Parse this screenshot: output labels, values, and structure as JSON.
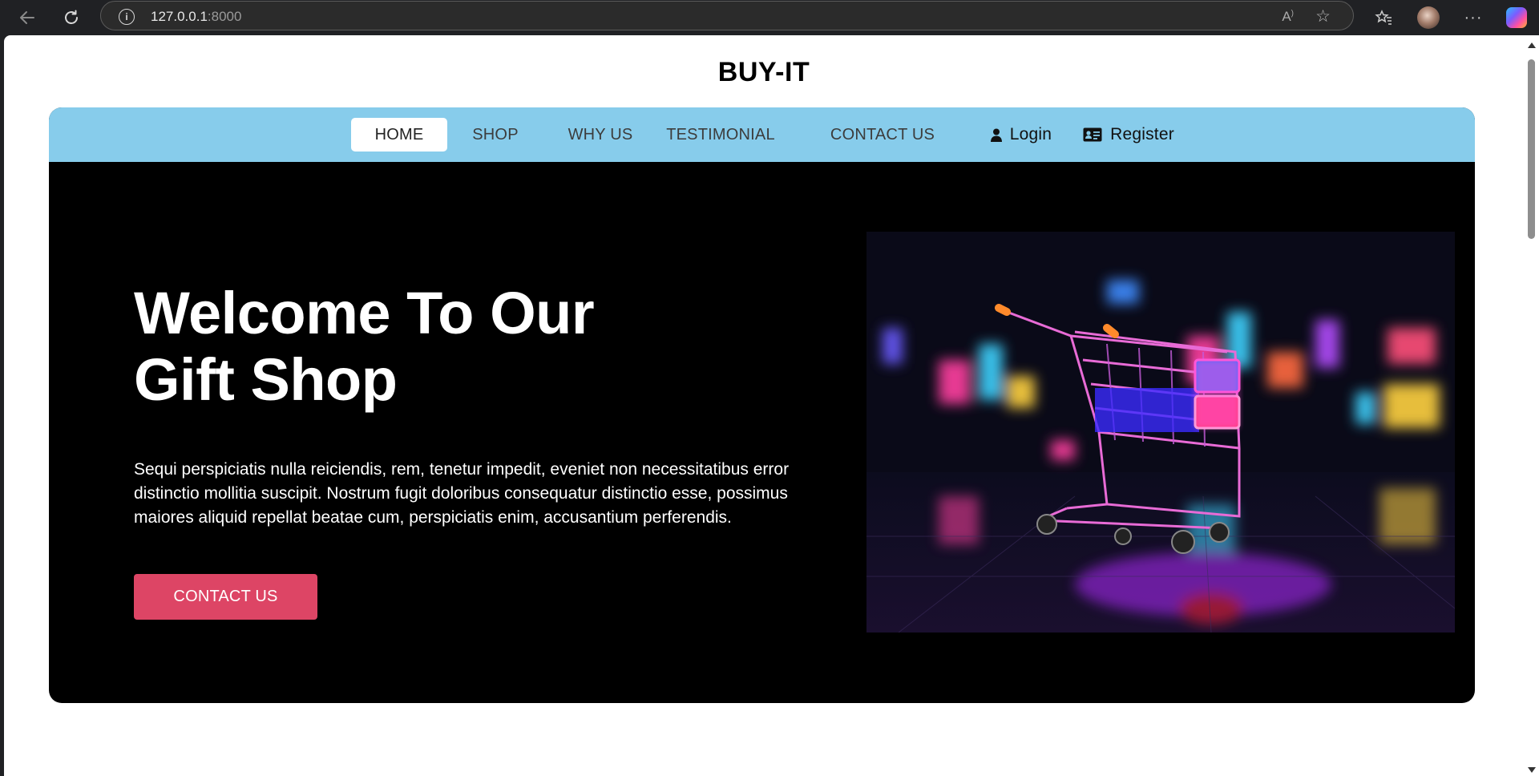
{
  "browser": {
    "url_host": "127.0.0.1",
    "url_port": ":8000"
  },
  "site": {
    "brand": "BUY-IT"
  },
  "nav": {
    "items": [
      {
        "label": "HOME",
        "active": true
      },
      {
        "label": "SHOP"
      },
      {
        "label": "WHY US"
      },
      {
        "label": "TESTIMONIAL"
      },
      {
        "label": "CONTACT US"
      }
    ],
    "login_label": "Login",
    "register_label": "Register"
  },
  "hero": {
    "title_line1": "Welcome To Our",
    "title_line2": "Gift Shop",
    "description": "Sequi perspiciatis nulla reiciendis, rem, tenetur impedit, eveniet non necessitatibus error distinctio mollitia suscipit. Nostrum fugit doloribus consequatur distinctio esse, possimus maiores aliquid repellat beatae cum, perspiciatis enim, accusantium perferendis.",
    "cta_label": "CONTACT US"
  },
  "colors": {
    "navbar": "#87cceb",
    "cta": "#dd4565",
    "hero_bg": "#000000"
  }
}
